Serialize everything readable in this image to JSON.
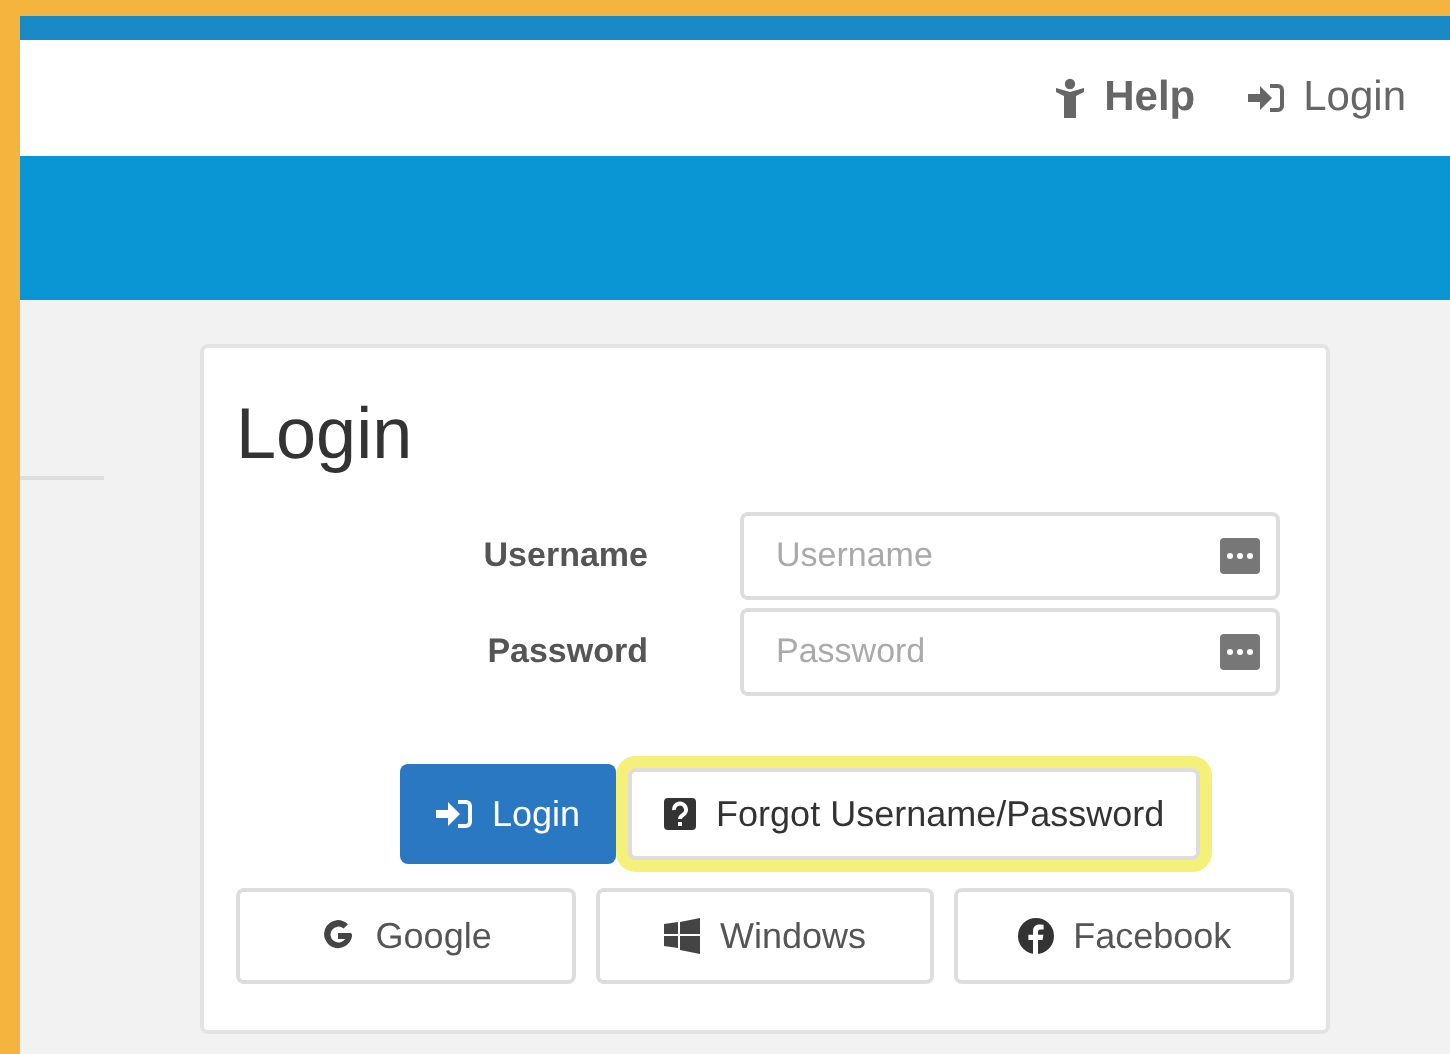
{
  "top_nav": [
    {
      "kind": "help",
      "label": "Help"
    },
    {
      "kind": "login",
      "label": "Login"
    }
  ],
  "login_panel": {
    "title": "Login",
    "fields": [
      {
        "label": "Username",
        "placeholder": "Username"
      },
      {
        "label": "Password",
        "placeholder": "Password"
      }
    ],
    "login_button": "Login",
    "forgot_button": {
      "label": "Forgot Username/Password",
      "highlighted": true
    },
    "social_buttons": [
      {
        "kind": "google",
        "label": "Google"
      },
      {
        "kind": "windows",
        "label": "Windows"
      },
      {
        "kind": "facebook",
        "label": "Facebook"
      }
    ]
  }
}
